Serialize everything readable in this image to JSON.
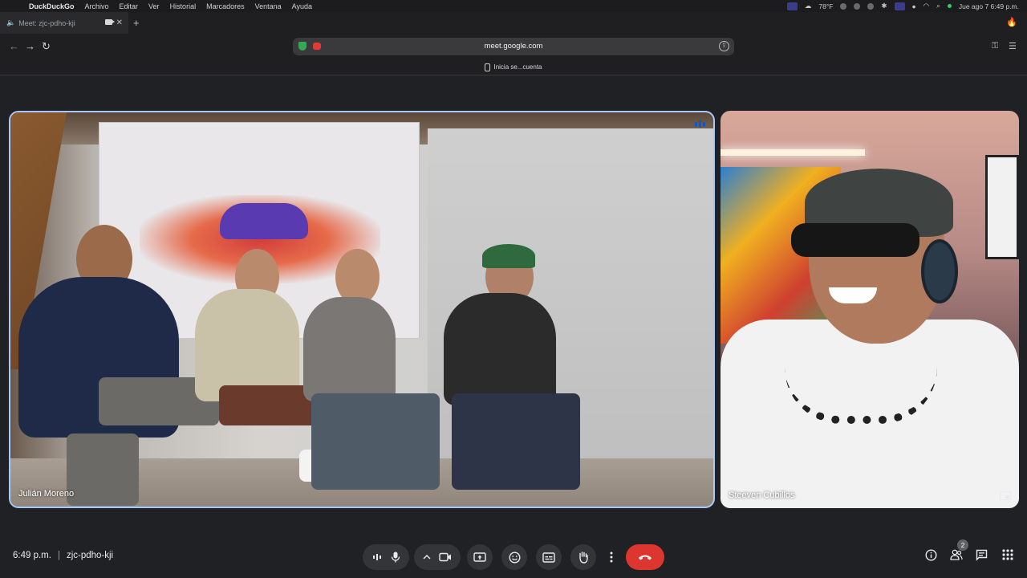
{
  "menubar": {
    "app": "DuckDuckGo",
    "items": [
      "Archivo",
      "Editar",
      "Ver",
      "Historial",
      "Marcadores",
      "Ventana",
      "Ayuda"
    ],
    "weather": "78°F",
    "clock": "Jue ago 7  6:49 p.m."
  },
  "browser": {
    "tab_title": "Meet: zjc-pdho-kji",
    "url": "meet.google.com",
    "signin_text": "Inicia se...cuenta"
  },
  "tiles": {
    "main_name": "Julián Moreno",
    "side_name": "Steeven Cubillos"
  },
  "meeting": {
    "time": "6:49 p.m.",
    "code": "zjc-pdho-kji",
    "participants_count": "2"
  },
  "colors": {
    "end_call": "#dc362e",
    "speaking_border": "#a8c7fa",
    "accent": "#0b57d0"
  }
}
